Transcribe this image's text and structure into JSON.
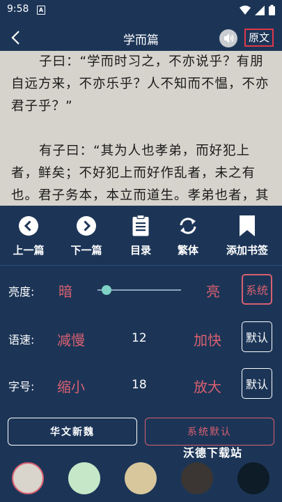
{
  "status_bar": {
    "time": "9:58",
    "sim_label": "A"
  },
  "header": {
    "title": "学而篇",
    "original_text_button": "原文"
  },
  "reader": {
    "paragraphs": [
      "子曰：“学而时习之，不亦说乎？有朋自远方来，不亦乐乎？人不知而不愠，不亦君子乎？”",
      "有子曰：“其为人也孝弟，而好犯上者，鲜矣；不好犯上而好作乱者，未之有也。君子务本，本立而道生。孝弟也者，其为仁之本与！”"
    ]
  },
  "toolbar": {
    "items": [
      {
        "label": "上一篇",
        "icon": "chevron-left-circle-icon"
      },
      {
        "label": "下一篇",
        "icon": "chevron-right-circle-icon"
      },
      {
        "label": "目录",
        "icon": "clipboard-list-icon"
      },
      {
        "label": "繁体",
        "icon": "sync-icon"
      },
      {
        "label": "添加书签",
        "icon": "bookmark-icon"
      }
    ]
  },
  "settings": {
    "brightness": {
      "label": "亮度:",
      "low": "暗",
      "high": "亮",
      "button": "系统",
      "level": 0.1
    },
    "speed": {
      "label": "语速:",
      "decrease": "减慢",
      "value": "12",
      "increase": "加快",
      "button": "默认"
    },
    "font_size": {
      "label": "字号:",
      "decrease": "缩小",
      "value": "18",
      "increase": "放大",
      "button": "默认"
    }
  },
  "font_buttons": {
    "font_name": "华文新魏",
    "system_default": "系统默认"
  },
  "watermark": "沃德下载站",
  "theme_colors": [
    "#d9d4cc",
    "#c6e8c8",
    "#d8c79c",
    "#3b3633",
    "#0e1c28"
  ],
  "colors": {
    "background": "#1c3557",
    "accent": "#d96070",
    "reader_bg": "#d6d3cc"
  }
}
